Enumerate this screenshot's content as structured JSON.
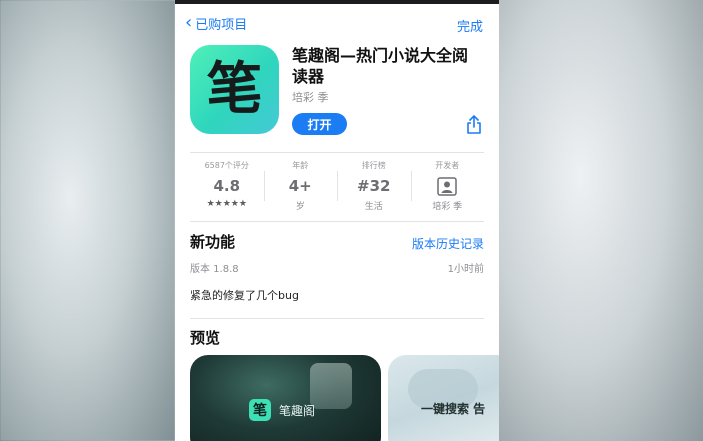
{
  "nav": {
    "back_label": "已购项目",
    "done_label": "完成"
  },
  "app": {
    "icon_glyph": "笔",
    "title": "笔趣阁—热门小说大全阅读器",
    "developer": "培彩 季",
    "open_label": "打开",
    "accent_color": "#1b7cf3"
  },
  "stats": {
    "ratings": {
      "label": "6587个评分",
      "value": "4.8",
      "stars": "★★★★★"
    },
    "age": {
      "label": "年龄",
      "value": "4+",
      "sub": "岁"
    },
    "chart": {
      "label": "排行榜",
      "value": "#32",
      "sub": "生活"
    },
    "developer": {
      "label": "开发者",
      "icon": "person-icon",
      "sub": "培彩 季"
    }
  },
  "whats_new": {
    "title": "新功能",
    "history_link": "版本历史记录",
    "version": "版本 1.8.8",
    "time": "1小时前",
    "notes": "紧急的修复了几个bug"
  },
  "preview": {
    "title": "预览",
    "shot1_logo": "笔",
    "shot1_text": "笔趣阁",
    "shot2_text": "一键搜索 告"
  }
}
